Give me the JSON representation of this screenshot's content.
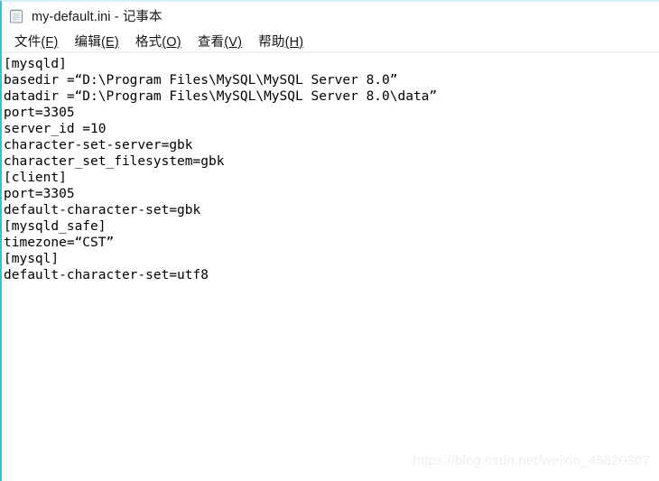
{
  "window": {
    "title": "my-default.ini - 记事本",
    "icon": "notepad-icon",
    "accent_color": "#2ec4d4",
    "background_color": "#ffffff"
  },
  "menubar": {
    "items": [
      {
        "label": "文件",
        "accel": "(F)"
      },
      {
        "label": "编辑",
        "accel": "(E)"
      },
      {
        "label": "格式",
        "accel": "(O)"
      },
      {
        "label": "查看",
        "accel": "(V)"
      },
      {
        "label": "帮助",
        "accel": "(H)"
      }
    ]
  },
  "document": {
    "filename": "my-default.ini",
    "text_color": "#000000",
    "lines": [
      "[mysqld]",
      "basedir =“D:\\Program Files\\MySQL\\MySQL Server 8.0”",
      "datadir =“D:\\Program Files\\MySQL\\MySQL Server 8.0\\data”",
      "port=3305",
      "server_id =10",
      "character-set-server=gbk",
      "character_set_filesystem=gbk",
      "[client]",
      "port=3305",
      "default-character-set=gbk",
      "[mysqld_safe]",
      "timezone=“CST”",
      "[mysql]",
      "default-character-set=utf8"
    ]
  },
  "watermark": {
    "text": "https://blog.csdn.net/weixin_45820307"
  }
}
